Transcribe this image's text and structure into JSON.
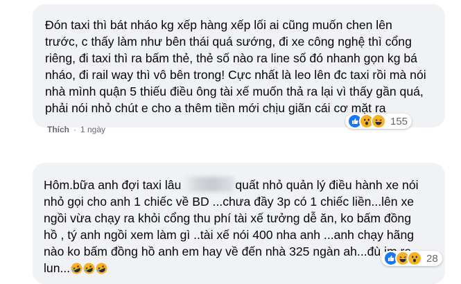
{
  "comments": [
    {
      "text": "Đón taxi thì bát nháo kg xếp hàng xếp lối ai cũng muốn chen lên\ntrước, c thấy làm như bên thái quá sướng, đi xe công nghệ thì cổng\nriêng, đi taxi thì ra bấm thẻ, thẻ số nào ra line số đó nhanh gọn kg bá\nnháo, đi rail way thì vô bên trong! Cực nhất là leo lên đc taxi rồi mà nói\nnhà mình quận 5 thiếu điều ông tài xế muốn thả ra lại vì thấy gần quá,\nphải nói nhỏ chút e cho a thêm tiền mới chịu giãn cái cơ mặt ra",
      "like_label": "Thích",
      "time": "1 ngày",
      "reaction_count": "155",
      "reaction_icons": [
        "like-icon",
        "wow-icon",
        "haha-icon"
      ]
    },
    {
      "text_before_blur": "Hôm.bữa anh đợi taxi lâu",
      "text_after_blur": "quất nhỏ quản lý điều hành xe nói\nnhỏ gọi cho anh 1 chiếc về BD ...chưa đầy 3p có 1 chiếc liền...lên xe\nngồi vừa chạy ra khỏi cổng thu phí tài xế tưởng dễ ăn, ko bấm đồng\nhồ , tý anh ngồi xem làm gì ..tài xế nói 400 nha anh ...anh chạy hãng\nnào ko bấm đồng hồ anh em hay về đến nhà 325 ngàn ah...đù im re\nlun...",
      "trailing_emojis": [
        "rofl-icon",
        "rofl-icon",
        "rofl-icon"
      ],
      "reaction_count": "28",
      "reaction_icons": [
        "like-icon",
        "haha-icon",
        "wow-icon"
      ]
    }
  ],
  "colors": {
    "bubble": "#f0f2f5",
    "text": "#050505",
    "meta": "#65676b",
    "like": "#1877f2",
    "emoji": "#f7b125"
  }
}
